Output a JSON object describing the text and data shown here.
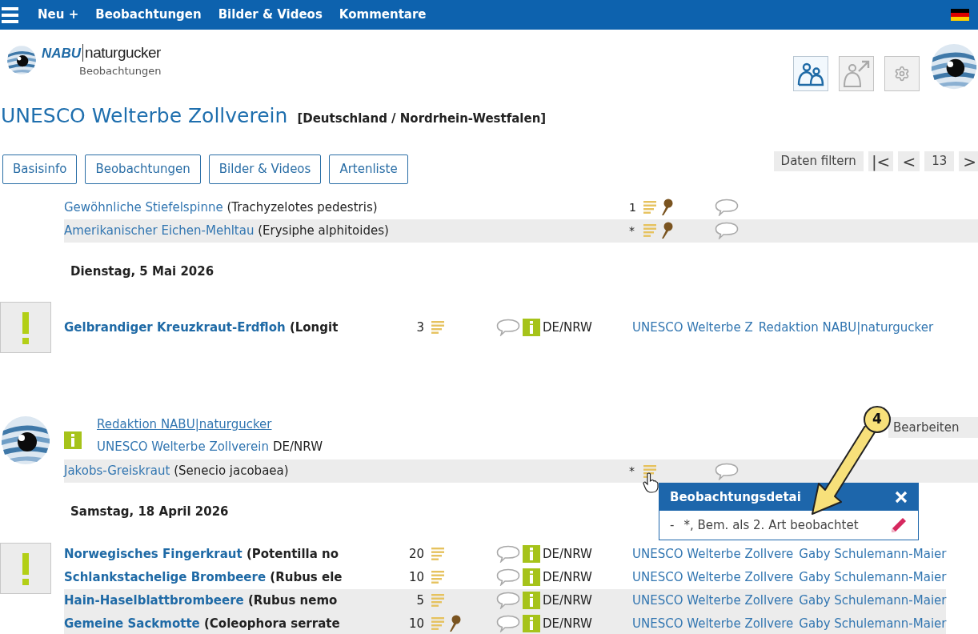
{
  "top_nav": {
    "items": [
      "Neu +",
      "Beobachtungen",
      "Bilder & Videos",
      "Kommentare"
    ]
  },
  "logo": {
    "brand": "NABU",
    "name": "naturgucker",
    "subtitle": "Beobachtungen"
  },
  "header_buttons": [
    {
      "kind": "people",
      "selected": true
    },
    {
      "kind": "person-arrow",
      "selected": false
    },
    {
      "kind": "gear",
      "selected": false
    }
  ],
  "title": "UNESCO Welterbe Zollverein",
  "region": "[Deutschland / Nordrhein-Westfalen]",
  "tabs": [
    "Basisinfo",
    "Beobachtungen",
    "Bilder & Videos",
    "Artenliste"
  ],
  "pager": {
    "filter": "Daten filtern",
    "first": "|<",
    "prev": "<",
    "page": "13",
    "next": ">"
  },
  "sections": [
    {
      "kind": "rows",
      "rows": [
        {
          "common": "Gewöhnliche Stiefelspinne",
          "scientific": "(Trachyzelotes pedestris)",
          "count": "1",
          "pin": true,
          "shaded": false
        },
        {
          "common": "Amerikanischer Eichen-Mehltau",
          "scientific": "(Erysiphe alphitoides)",
          "count": "*",
          "pin": true,
          "shaded": true
        }
      ]
    },
    {
      "kind": "date",
      "text": "Dienstag, 5 Mai 2026"
    },
    {
      "kind": "group",
      "rows": [
        {
          "common": "Gelbrandiger Kreuzkraut-Erdfloh",
          "scientific": "(Longit",
          "count": "3",
          "pin": false,
          "shaded": false,
          "region": "DE/NRW",
          "site": "UNESCO Welterbe Z",
          "observer": "Redaktion NABU|naturgucker"
        }
      ]
    },
    {
      "kind": "author",
      "author": "Redaktion NABU|naturgucker",
      "site": "UNESCO Welterbe Zollverein",
      "region": "DE/NRW",
      "action": "Bearbeiten",
      "rows": [
        {
          "common": "Jakobs-Greiskraut",
          "scientific": "(Senecio jacobaea)",
          "count": "*",
          "pin": false,
          "shaded": true
        }
      ]
    },
    {
      "kind": "date",
      "text": "Samstag, 18 April 2026"
    },
    {
      "kind": "group",
      "rows": [
        {
          "common": "Norwegisches Fingerkraut",
          "scientific": "(Potentilla no",
          "count": "20",
          "pin": false,
          "shaded": false,
          "region": "DE/NRW",
          "site": "UNESCO Welterbe Zollvere",
          "observer": "Gaby Schulemann-Maier"
        },
        {
          "common": "Schlankstachelige Brombeere",
          "scientific": "(Rubus ele",
          "count": "10",
          "pin": false,
          "shaded": false,
          "region": "DE/NRW",
          "site": "UNESCO Welterbe Zollvere",
          "observer": "Gaby Schulemann-Maier"
        },
        {
          "common": "Hain-Haselblattbrombeere",
          "scientific": "(Rubus nemo",
          "count": "5",
          "pin": false,
          "shaded": true,
          "region": "DE/NRW",
          "site": "UNESCO Welterbe Zollvere",
          "observer": "Gaby Schulemann-Maier"
        },
        {
          "common": "Gemeine Sackmotte",
          "scientific": "(Coleophora serrate",
          "count": "10",
          "pin": true,
          "shaded": true,
          "region": "DE/NRW",
          "site": "UNESCO Welterbe Zollvere",
          "observer": "Gaby Schulemann-Maier"
        }
      ]
    }
  ],
  "popup": {
    "title": "Beobachtungsdetai",
    "dash": "-",
    "text": "*, Bem. als 2. Art beobachtet"
  },
  "callout": {
    "number": "4"
  }
}
